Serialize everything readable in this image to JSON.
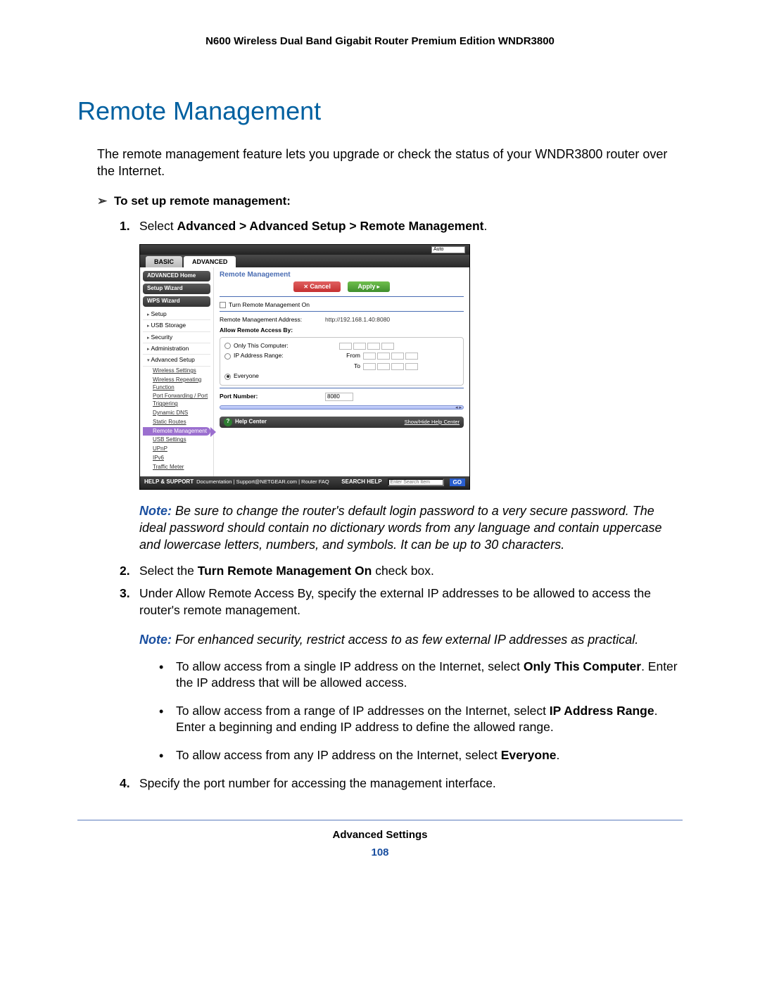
{
  "product_header": "N600 Wireless Dual Band Gigabit Router Premium Edition WNDR3800",
  "section_title": "Remote Management",
  "intro": "The remote management feature lets you upgrade or check the status of your WNDR3800 router over the Internet.",
  "task_heading": "To set up remote management:",
  "steps": {
    "s1_pre": "Select ",
    "s1_bold": "Advanced > Advanced Setup > Remote Management",
    "s1_post": ".",
    "s2_pre": "Select the ",
    "s2_bold": "Turn Remote Management On",
    "s2_post": " check box.",
    "s3": "Under Allow Remote Access By, specify the external IP addresses to be allowed to access the router's remote management.",
    "s4": "Specify the port number for accessing the management interface."
  },
  "note1": {
    "label": "Note:",
    "text": "  Be sure to change the router's default login password to a very secure password. The ideal password should contain no dictionary words from any language and contain uppercase and lowercase letters, numbers, and symbols. It can be up to 30 characters."
  },
  "note2": {
    "label": "Note:",
    "text": "  For enhanced security, restrict access to as few external IP addresses as practical."
  },
  "bullets": {
    "b1_pre": "To allow access from a single IP address on the Internet, select ",
    "b1_bold": "Only This Computer",
    "b1_post": ". Enter the IP address that will be allowed access.",
    "b2_pre": "To allow access from a range of IP addresses on the Internet, select ",
    "b2_bold": "IP Address Range",
    "b2_post": ". Enter a beginning and ending IP address to define the allowed range.",
    "b3_pre": "To allow access from any IP address on the Internet, select ",
    "b3_bold": "Everyone",
    "b3_post": "."
  },
  "screenshot": {
    "lang": "Auto",
    "tabs": {
      "basic": "BASIC",
      "advanced": "ADVANCED"
    },
    "side_pills": [
      "ADVANCED Home",
      "Setup Wizard",
      "WPS Wizard"
    ],
    "side_tree": [
      "Setup",
      "USB Storage",
      "Security",
      "Administration",
      "Advanced Setup"
    ],
    "side_subs": [
      "Wireless Settings",
      "Wireless Repeating Function",
      "Port Forwarding / Port Triggering",
      "Dynamic DNS",
      "Static Routes",
      "Remote Management",
      "USB Settings",
      "UPnP",
      "IPv6",
      "Traffic Meter"
    ],
    "crumb": "Remote Management",
    "btn_cancel": "Cancel",
    "btn_apply": "Apply",
    "chk_label": "Turn Remote Management On",
    "addr_label": "Remote Management Address:",
    "addr_value": "http://192.168.1.40:8080",
    "allow_head": "Allow Remote Access By:",
    "opt_only": "Only This Computer:",
    "opt_range": "IP Address Range:",
    "opt_every": "Everyone",
    "from": "From",
    "to": "To",
    "port_label": "Port Number:",
    "port_value": "8080",
    "helpcenter": "Help Center",
    "help_link": "Show/Hide Help Center",
    "footer_hs": "HELP & SUPPORT",
    "footer_links": "Documentation | Support@NETGEAR.com | Router FAQ",
    "search_label": "SEARCH HELP",
    "search_placeholder": "Enter Search Item",
    "go": "GO"
  },
  "footer_section": "Advanced Settings",
  "footer_page": "108"
}
